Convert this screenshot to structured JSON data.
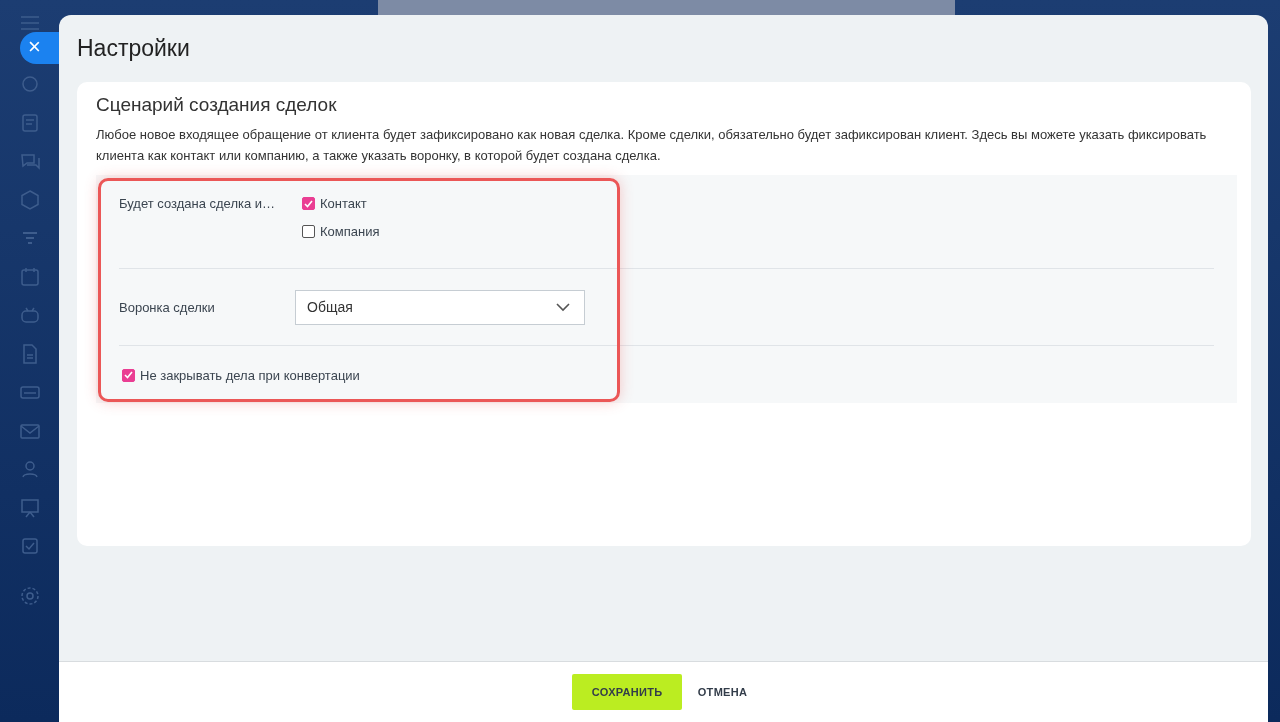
{
  "panel": {
    "title": "Настройки",
    "close_label": "×"
  },
  "card": {
    "title": "Сценарий создания сделок",
    "description": "Любое новое входящее обращение от клиента будет зафиксировано как новая сделка. Кроме сделки, обязательно будет зафиксирован клиент. Здесь вы можете указать фиксировать клиента как контакт или компанию, а также указать воронку, в которой будет создана сделка.",
    "client_row": {
      "label": "Будет создана сделка и…",
      "options": [
        {
          "label": "Контакт",
          "checked": true
        },
        {
          "label": "Компания",
          "checked": false
        }
      ]
    },
    "pipeline_row": {
      "label": "Воронка сделки",
      "value": "Общая"
    },
    "keep_activities": {
      "label": "Не закрывать дела при конвертации",
      "checked": true
    }
  },
  "footer": {
    "buttons": [
      {
        "label": "СОХРАНИТЬ",
        "kind": "primary"
      },
      {
        "label": "ОТМЕНА",
        "kind": "link"
      }
    ]
  }
}
